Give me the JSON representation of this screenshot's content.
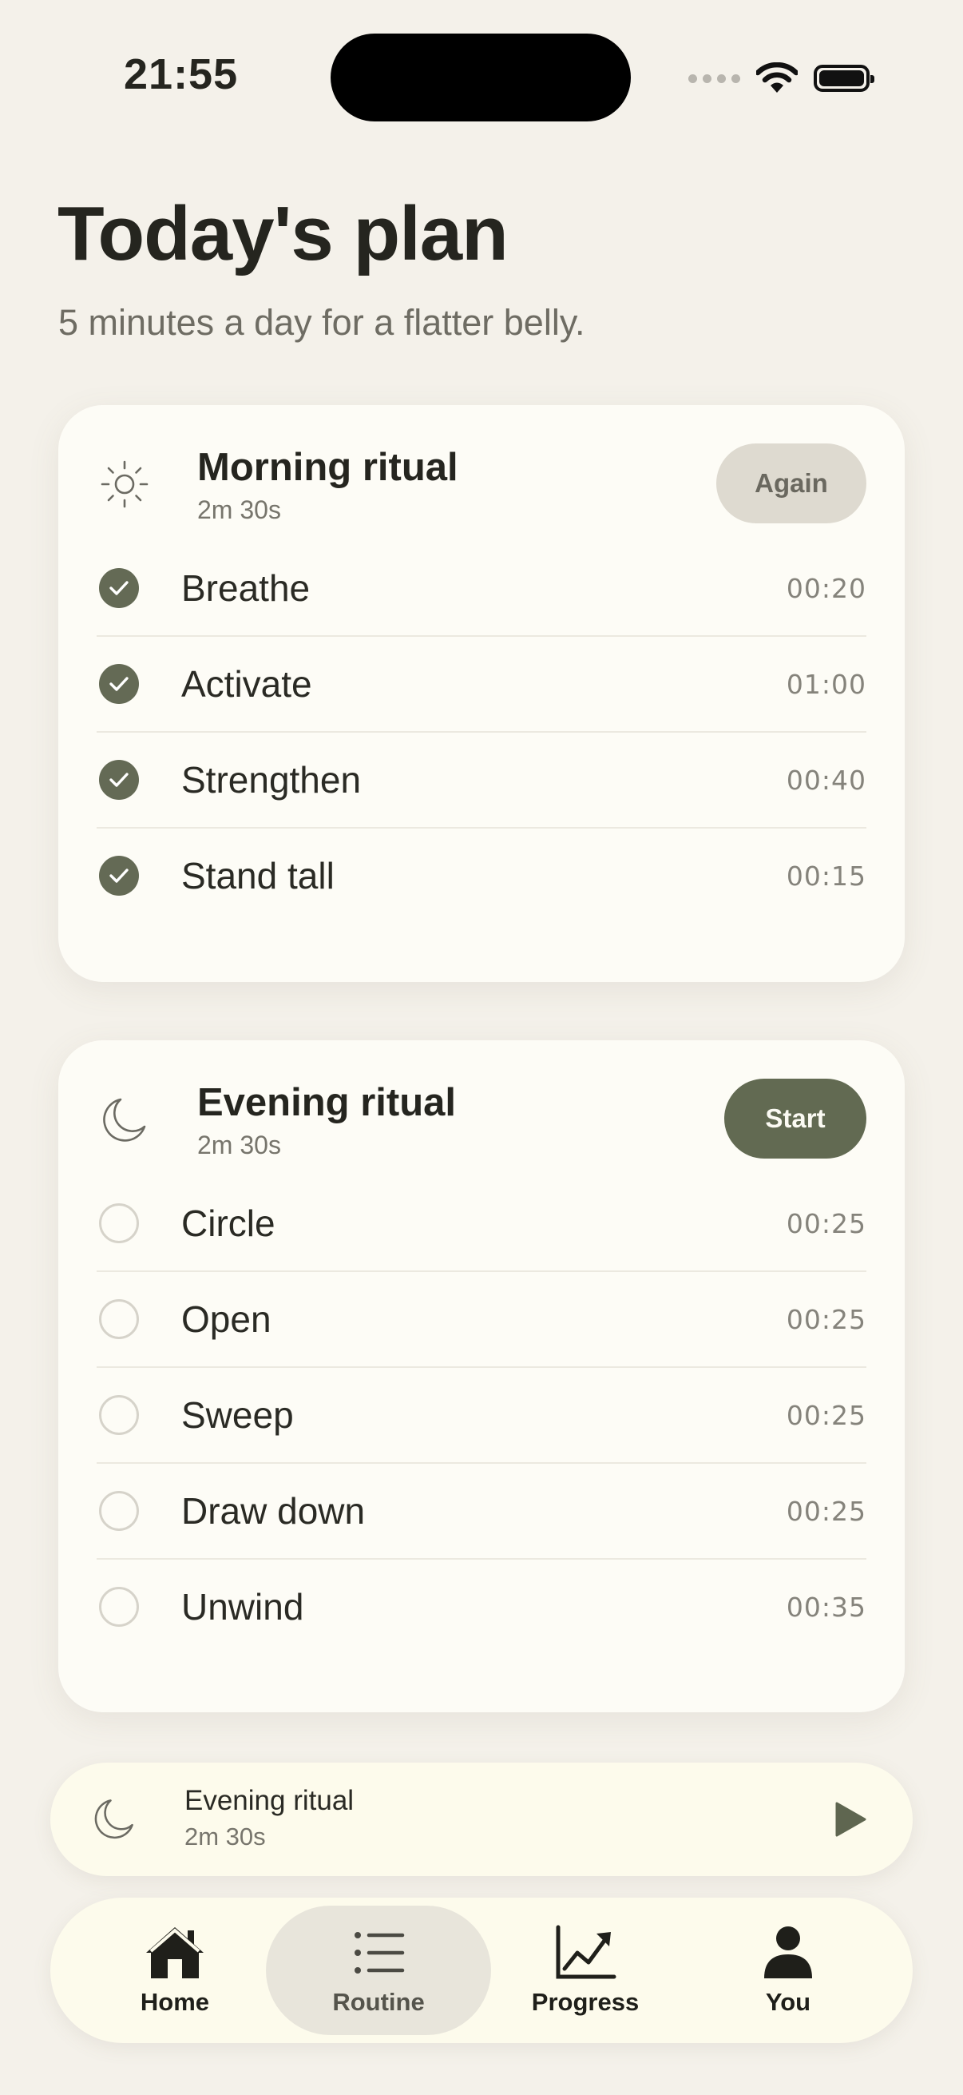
{
  "status_bar": {
    "time": "21:55"
  },
  "header": {
    "title": "Today's plan",
    "subtitle": "5 minutes a day for a flatter belly."
  },
  "morning": {
    "icon": "sun-icon",
    "title": "Morning ritual",
    "duration": "2m 30s",
    "button": "Again",
    "steps": [
      {
        "name": "Breathe",
        "time": "00:20",
        "done": true
      },
      {
        "name": "Activate",
        "time": "01:00",
        "done": true
      },
      {
        "name": "Strengthen",
        "time": "00:40",
        "done": true
      },
      {
        "name": "Stand tall",
        "time": "00:15",
        "done": true
      }
    ]
  },
  "evening": {
    "icon": "moon-icon",
    "title": "Evening ritual",
    "duration": "2m 30s",
    "button": "Start",
    "steps": [
      {
        "name": "Circle",
        "time": "00:25",
        "done": false
      },
      {
        "name": "Open",
        "time": "00:25",
        "done": false
      },
      {
        "name": "Sweep",
        "time": "00:25",
        "done": false
      },
      {
        "name": "Draw down",
        "time": "00:25",
        "done": false
      },
      {
        "name": "Unwind",
        "time": "00:35",
        "done": false
      }
    ]
  },
  "player": {
    "icon": "moon-icon",
    "title": "Evening ritual",
    "duration": "2m 30s",
    "action_icon": "play-icon"
  },
  "tabs": [
    {
      "label": "Home",
      "icon": "home-icon",
      "active": false
    },
    {
      "label": "Routine",
      "icon": "list-icon",
      "active": true
    },
    {
      "label": "Progress",
      "icon": "chart-icon",
      "active": false
    },
    {
      "label": "You",
      "icon": "person-icon",
      "active": false
    }
  ],
  "colors": {
    "background": "#f4f1ea",
    "card": "#fdfcf6",
    "accent": "#626a52",
    "muted_button": "#dedad0"
  }
}
